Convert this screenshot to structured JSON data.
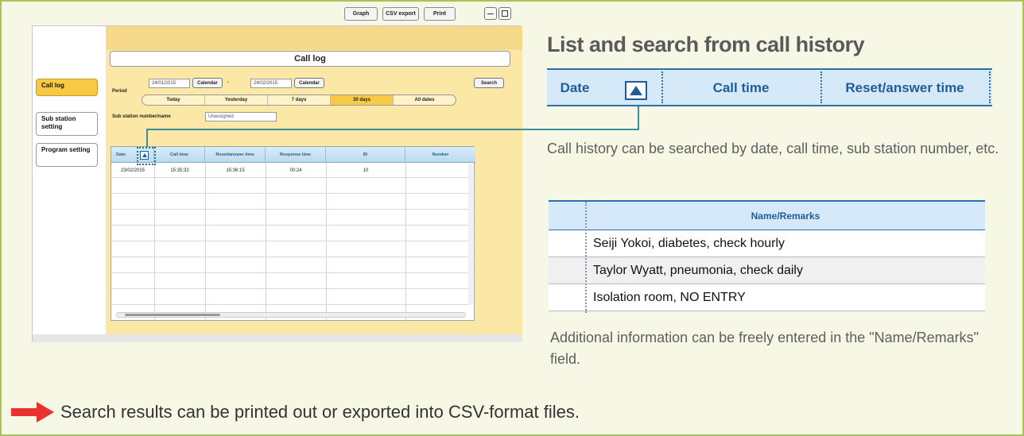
{
  "heading": "List and search from call history",
  "column_header": {
    "date": "Date",
    "call_time": "Call time",
    "reset_answer_time": "Reset/answer time"
  },
  "description_search": "Call history can be searched by date, call time, sub station number, etc.",
  "remarks": {
    "header": "Name/Remarks",
    "rows": [
      "Seiji Yokoi, diabetes, check hourly",
      "Taylor Wyatt, pneumonia, check daily",
      "Isolation room, NO ENTRY"
    ]
  },
  "description_remarks": "Additional information can be freely entered in the \"Name/Remarks\" field.",
  "footer": "Search results can be printed out or exported into CSV-format files.",
  "app": {
    "title": "Call log",
    "toolbar": {
      "graph": "Graph",
      "csv_export": "CSV export",
      "print": "Print"
    },
    "sidebar": [
      "Call log",
      "Sub station setting",
      "Program setting"
    ],
    "period_label": "Period",
    "from_date": "24/01/2015",
    "to_date": "24/02/2015",
    "calendar": "Calendar",
    "date_separator": "-",
    "search": "Search",
    "period_options": [
      "Today",
      "Yesterday",
      "7 days",
      "30 days",
      "All dates"
    ],
    "substation_label": "Sub station number/name",
    "substation_select": "Unassigned",
    "grid": {
      "headers": [
        "Date",
        "Call time",
        "Reset/answer time",
        "Response time",
        "ID",
        "Number"
      ],
      "rows": [
        [
          "23/02/2015",
          "15:35:32",
          "15:36:15",
          "00:24",
          "10",
          ""
        ]
      ]
    }
  },
  "colors": {
    "panel_bg": "#f6f7e4",
    "panel_border": "#a9c25a",
    "accent_blue": "#1f5d99",
    "header_blue": "#d6e9f8",
    "active_yellow": "#f7c945",
    "arrow_red": "#e8322e"
  }
}
